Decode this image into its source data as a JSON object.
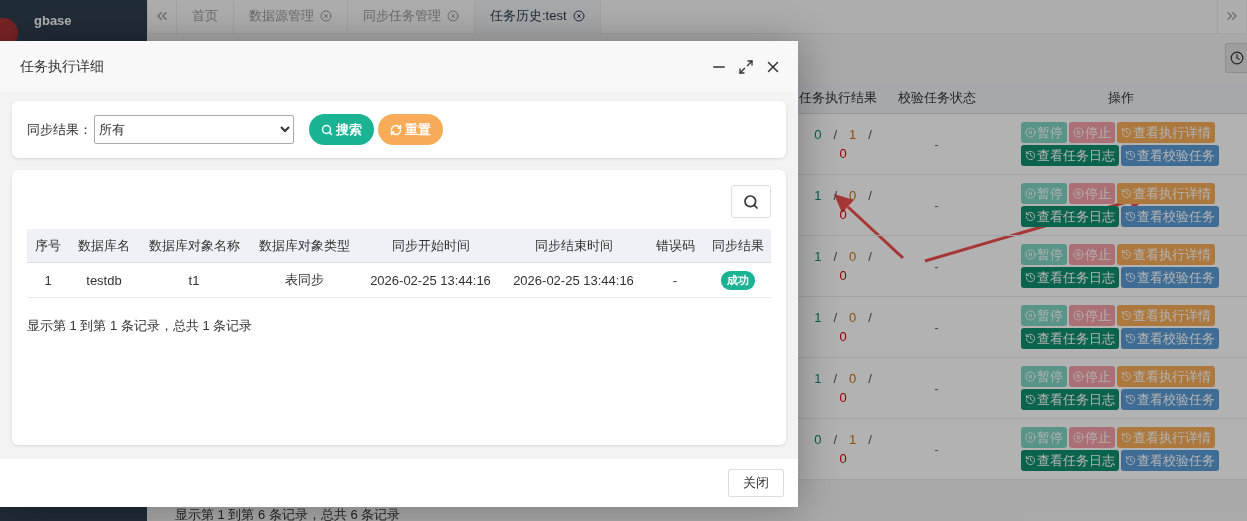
{
  "sidebar": {
    "username": "gbase"
  },
  "tabs": [
    {
      "label": "首页",
      "closable": false,
      "selected": false
    },
    {
      "label": "数据源管理",
      "closable": true,
      "selected": false
    },
    {
      "label": "同步任务管理",
      "closable": true,
      "selected": false
    },
    {
      "label": "任务历史:test",
      "closable": true,
      "selected": true
    }
  ],
  "table": {
    "columns": [
      "任务执行结果",
      "校验任务状态",
      "操作"
    ],
    "rows": [
      {
        "counts": [
          {
            "value": "0",
            "kind": "success"
          },
          {
            "value": "/",
            "kind": "sep"
          },
          {
            "value": "1",
            "kind": "failed"
          },
          {
            "value": "/",
            "kind": "sep"
          },
          {
            "value": "0",
            "kind": "error"
          }
        ],
        "verify_status": "-",
        "actions": [
          {
            "label": "暂停",
            "kind": "pause",
            "disabled": true
          },
          {
            "label": "停止",
            "kind": "stop",
            "disabled": true
          },
          {
            "label": "查看执行详情",
            "kind": "detail",
            "disabled": false
          },
          {
            "label": "查看任务日志",
            "kind": "log",
            "disabled": false
          },
          {
            "label": "查看校验任务",
            "kind": "verify",
            "disabled": false
          }
        ]
      },
      {
        "counts": [
          {
            "value": "1",
            "kind": "success"
          },
          {
            "value": "/",
            "kind": "sep"
          },
          {
            "value": "0",
            "kind": "failed"
          },
          {
            "value": "/",
            "kind": "sep"
          },
          {
            "value": "0",
            "kind": "error"
          }
        ],
        "verify_status": "-",
        "actions": [
          {
            "label": "暂停",
            "kind": "pause",
            "disabled": true
          },
          {
            "label": "停止",
            "kind": "stop",
            "disabled": true
          },
          {
            "label": "查看执行详情",
            "kind": "detail",
            "disabled": false
          },
          {
            "label": "查看任务日志",
            "kind": "log",
            "disabled": false
          },
          {
            "label": "查看校验任务",
            "kind": "verify",
            "disabled": false
          }
        ]
      },
      {
        "counts": [
          {
            "value": "1",
            "kind": "success"
          },
          {
            "value": "/",
            "kind": "sep"
          },
          {
            "value": "0",
            "kind": "failed"
          },
          {
            "value": "/",
            "kind": "sep"
          },
          {
            "value": "0",
            "kind": "error"
          }
        ],
        "verify_status": "-",
        "actions": [
          {
            "label": "暂停",
            "kind": "pause",
            "disabled": true
          },
          {
            "label": "停止",
            "kind": "stop",
            "disabled": true
          },
          {
            "label": "查看执行详情",
            "kind": "detail",
            "disabled": false
          },
          {
            "label": "查看任务日志",
            "kind": "log",
            "disabled": false
          },
          {
            "label": "查看校验任务",
            "kind": "verify",
            "disabled": false
          }
        ]
      },
      {
        "counts": [
          {
            "value": "1",
            "kind": "success"
          },
          {
            "value": "/",
            "kind": "sep"
          },
          {
            "value": "0",
            "kind": "failed"
          },
          {
            "value": "/",
            "kind": "sep"
          },
          {
            "value": "0",
            "kind": "error"
          }
        ],
        "verify_status": "-",
        "actions": [
          {
            "label": "暂停",
            "kind": "pause",
            "disabled": true
          },
          {
            "label": "停止",
            "kind": "stop",
            "disabled": true
          },
          {
            "label": "查看执行详情",
            "kind": "detail",
            "disabled": false
          },
          {
            "label": "查看任务日志",
            "kind": "log",
            "disabled": false
          },
          {
            "label": "查看校验任务",
            "kind": "verify",
            "disabled": false
          }
        ]
      },
      {
        "counts": [
          {
            "value": "1",
            "kind": "success"
          },
          {
            "value": "/",
            "kind": "sep"
          },
          {
            "value": "0",
            "kind": "failed"
          },
          {
            "value": "/",
            "kind": "sep"
          },
          {
            "value": "0",
            "kind": "error"
          }
        ],
        "verify_status": "-",
        "actions": [
          {
            "label": "暂停",
            "kind": "pause",
            "disabled": true
          },
          {
            "label": "停止",
            "kind": "stop",
            "disabled": true
          },
          {
            "label": "查看执行详情",
            "kind": "detail",
            "disabled": false
          },
          {
            "label": "查看任务日志",
            "kind": "log",
            "disabled": false
          },
          {
            "label": "查看校验任务",
            "kind": "verify",
            "disabled": false
          }
        ]
      },
      {
        "counts": [
          {
            "value": "0",
            "kind": "success"
          },
          {
            "value": "/",
            "kind": "sep"
          },
          {
            "value": "1",
            "kind": "failed"
          },
          {
            "value": "/",
            "kind": "sep"
          },
          {
            "value": "0",
            "kind": "error"
          }
        ],
        "verify_status": "-",
        "actions": [
          {
            "label": "暂停",
            "kind": "pause",
            "disabled": true
          },
          {
            "label": "停止",
            "kind": "stop",
            "disabled": true
          },
          {
            "label": "查看执行详情",
            "kind": "detail",
            "disabled": false
          },
          {
            "label": "查看任务日志",
            "kind": "log",
            "disabled": false
          },
          {
            "label": "查看校验任务",
            "kind": "verify",
            "disabled": false
          }
        ]
      }
    ],
    "footer": "显示第 1 到第 6 条记录，总共 6 条记录"
  },
  "dialog": {
    "title": "任务执行详细",
    "filter": {
      "label": "同步结果：",
      "value": "所有",
      "search_button": "搜索",
      "reset_button": "重置"
    },
    "table": {
      "columns": [
        "序号",
        "数据库名",
        "数据库对象名称",
        "数据库对象类型",
        "同步开始时间",
        "同步结束时间",
        "错误码",
        "同步结果"
      ],
      "rows": [
        {
          "cells": [
            "1",
            "testdb",
            "t1",
            "表同步",
            "2026-02-25 13:44:16",
            "2026-02-25 13:44:16",
            "-"
          ],
          "result": {
            "label": "成功",
            "kind": "success"
          }
        }
      ]
    },
    "summary": "显示第 1 到第 1 条记录，总共 1 条记录",
    "close_button": "关闭"
  }
}
